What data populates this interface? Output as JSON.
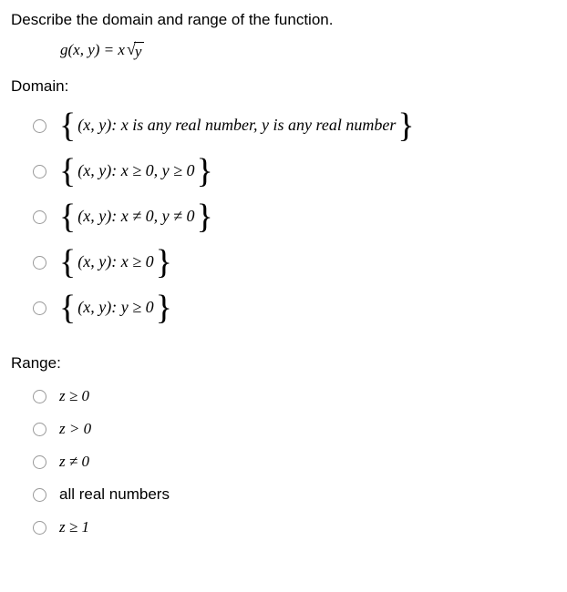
{
  "question": "Describe the domain and range of the function.",
  "formula_lhs": "g(x, y) = x",
  "formula_radicand": "y",
  "domain_label": "Domain:",
  "domain_options": [
    "(x, y): x is any real number, y is any real number",
    "(x, y): x ≥ 0, y ≥ 0",
    "(x, y): x ≠ 0, y ≠ 0",
    "(x, y): x ≥ 0",
    "(x, y): y ≥ 0"
  ],
  "range_label": "Range:",
  "range_options": [
    "z ≥ 0",
    "z > 0",
    "z ≠ 0",
    "all real numbers",
    "z ≥ 1"
  ]
}
